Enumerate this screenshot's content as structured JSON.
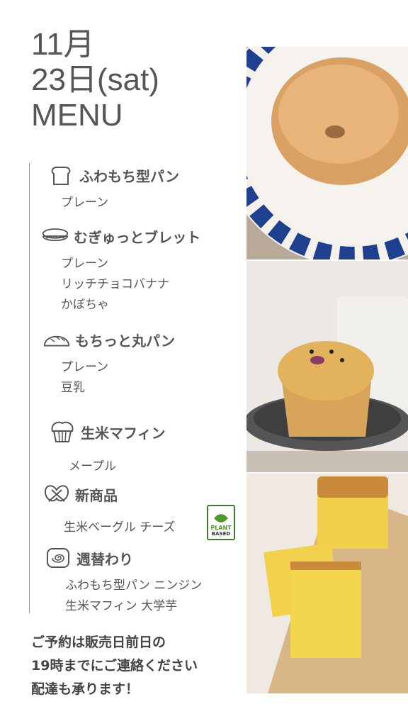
{
  "header": {
    "line1": "11月",
    "line2": "23日(sat)",
    "line3": "MENU"
  },
  "sections": [
    {
      "icon": "bread-slice-icon",
      "title": "ふわもち型パン",
      "items": [
        "プレーン"
      ]
    },
    {
      "icon": "bagel-icon",
      "title": "むぎゅっとブレット",
      "items": [
        "プレーン",
        "リッチチョコバナナ",
        "かぼちゃ"
      ]
    },
    {
      "icon": "round-bread-icon",
      "title": "もちっと丸パン",
      "items": [
        "プレーン",
        "豆乳"
      ]
    },
    {
      "icon": "muffin-icon",
      "title": "生米マフィン",
      "items": [
        "メープル"
      ]
    },
    {
      "icon": "pretzel-icon",
      "title": "新商品",
      "items": [
        "生米ベーグル チーズ"
      ]
    },
    {
      "icon": "cinnamon-roll-icon",
      "title": "週替わり",
      "items": [
        "ふわもち型パン ニンジン",
        "生米マフィン 大学芋"
      ]
    }
  ],
  "badge": {
    "line1": "PLANT",
    "line2": "BASED"
  },
  "footer": {
    "line1": "ご予約は販売日前日の",
    "line2": "19時までにご連絡ください",
    "line3": "配達も承ります！"
  },
  "colors": {
    "text": "#555555",
    "plant_green": "#4c9a2a",
    "plate_blue": "#1f3f8f"
  }
}
